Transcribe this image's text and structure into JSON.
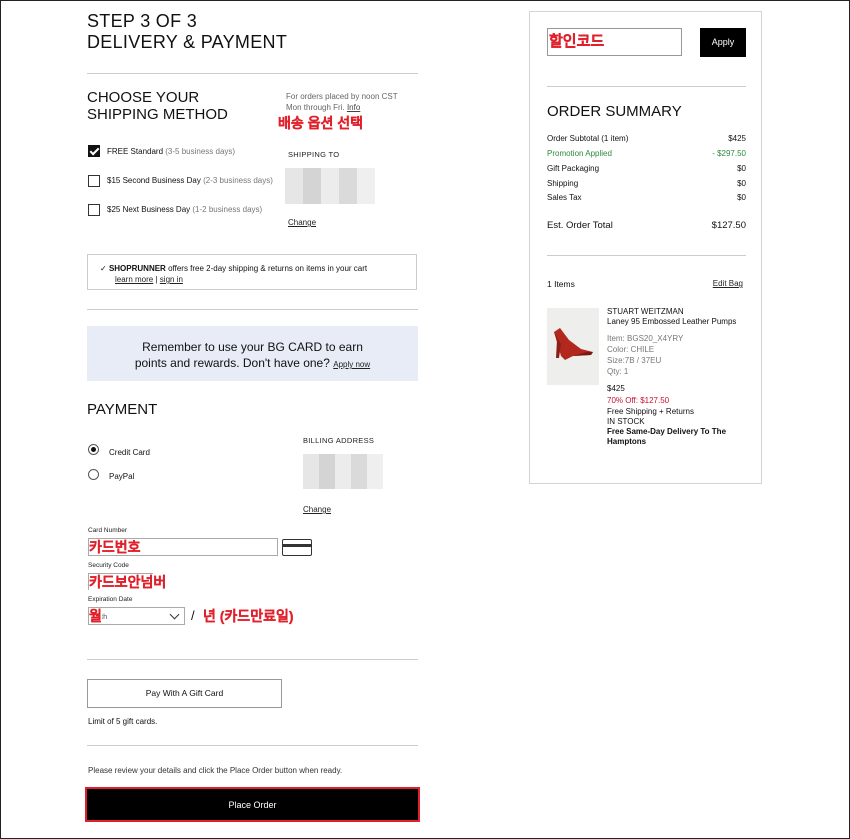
{
  "step": {
    "line1": "STEP 3 OF 3",
    "line2": "DELIVERY & PAYMENT"
  },
  "shipping": {
    "heading_line1": "CHOOSE YOUR",
    "heading_line2": "SHIPPING METHOD",
    "note_line1": "For orders placed by noon CST",
    "note_line2": "Mon through Fri.",
    "note_link": "Info",
    "annotation": "배송 옵션 선택",
    "options": [
      {
        "name": "FREE Standard",
        "detail": "(3-5 business days)",
        "checked": true
      },
      {
        "name": "$15 Second Business Day",
        "detail": "(2-3 business days)",
        "checked": false
      },
      {
        "name": "$25 Next Business Day",
        "detail": "(1-2 business days)",
        "checked": false
      }
    ],
    "shipping_to_label": "SHIPPING TO",
    "change_link": "Change"
  },
  "shoprunner": {
    "brand": "SHOPRUNNER",
    "text": "offers free 2-day shipping & returns on items in your cart",
    "learn_more": "learn more",
    "separator": "|",
    "sign_in": "sign in"
  },
  "banner": {
    "line1": "Remember to use your BG CARD to earn",
    "line2": "points and rewards. Don't have one?",
    "apply_link": "Apply now"
  },
  "payment": {
    "heading": "PAYMENT",
    "methods": [
      {
        "label": "Credit Card",
        "selected": true
      },
      {
        "label": "PayPal",
        "selected": false
      }
    ],
    "billing_label": "BILLING ADDRESS",
    "change_link": "Change",
    "card_number_label": "Card Number",
    "card_number_annotation": "카드번호",
    "security_code_label": "Security Code",
    "security_code_annotation": "카드보안넘버",
    "expiration_label": "Expiration Date",
    "month_annotation": "월",
    "month_placeholder_tail": "th",
    "slash": "/",
    "year_annotation": "년 (카드만료일)"
  },
  "gift": {
    "button": "Pay With A Gift Card",
    "limit": "Limit of 5 gift cards."
  },
  "review_text": "Please review your details and click the Place Order button when ready.",
  "place_order": "Place Order",
  "promo": {
    "annotation": "할인코드",
    "apply": "Apply"
  },
  "summary": {
    "heading": "ORDER SUMMARY",
    "rows": [
      {
        "label": "Order Subtotal (1 item)",
        "value": "$425",
        "highlight": false
      },
      {
        "label": "Promotion Applied",
        "value": "- $297.50",
        "highlight": true
      },
      {
        "label": "Gift Packaging",
        "value": "$0",
        "highlight": false
      },
      {
        "label": "Shipping",
        "value": "$0",
        "highlight": false
      },
      {
        "label": "Sales Tax",
        "value": "$0",
        "highlight": false
      }
    ],
    "total_label": "Est. Order Total",
    "total_value": "$127.50",
    "items_count": "1 Items",
    "edit_bag": "Edit Bag",
    "item": {
      "brand": "STUART WEITZMAN",
      "name": "Laney 95 Embossed Leather Pumps",
      "item_no": "Item: BGS20_X4YRY",
      "color": "Color: CHILE",
      "size": "Size:7B / 37EU",
      "qty": "Qty: 1",
      "price": "$425",
      "discount": "70% Off: $127.50",
      "shipping_line": "Free Shipping + Returns",
      "stock": "IN STOCK",
      "delivery": "Free Same-Day Delivery To The Hamptons"
    }
  },
  "colors": {
    "accent_red": "#e0202a",
    "promo_green": "#2e8b3d",
    "discount_red": "#c8102e",
    "banner_bg": "#e8ecf7"
  }
}
